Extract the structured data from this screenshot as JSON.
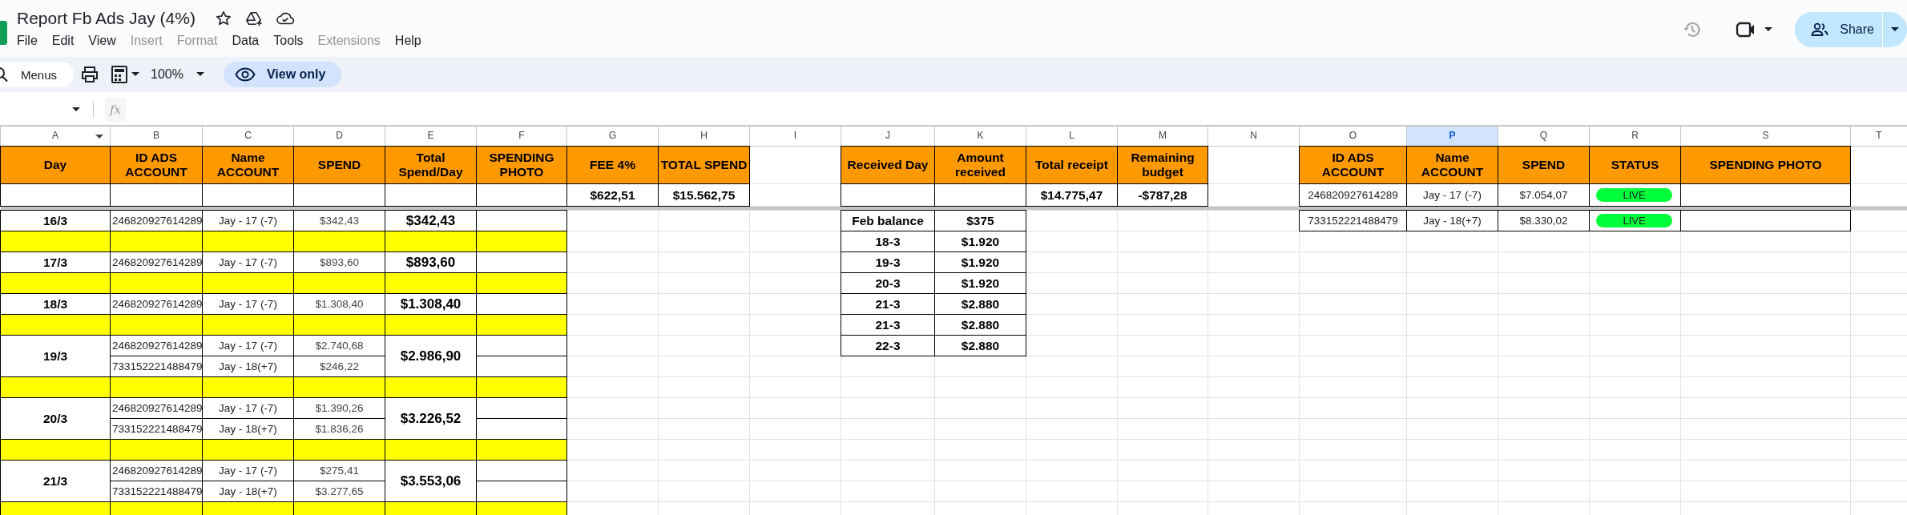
{
  "title": "Report Fb Ads Jay (4%)",
  "menu": [
    {
      "label": "File",
      "disabled": false
    },
    {
      "label": "Edit",
      "disabled": false
    },
    {
      "label": "View",
      "disabled": false
    },
    {
      "label": "Insert",
      "disabled": true
    },
    {
      "label": "Format",
      "disabled": true
    },
    {
      "label": "Data",
      "disabled": false
    },
    {
      "label": "Tools",
      "disabled": false
    },
    {
      "label": "Extensions",
      "disabled": true
    },
    {
      "label": "Help",
      "disabled": false
    }
  ],
  "toolbar": {
    "search_placeholder": "Menus",
    "zoom": "100%",
    "mode": "View only"
  },
  "share": {
    "label": "Share"
  },
  "formula_bar": {
    "fx": "fx"
  },
  "columns": [
    {
      "letter": "A",
      "selected": false
    },
    {
      "letter": "B",
      "selected": false
    },
    {
      "letter": "C",
      "selected": false
    },
    {
      "letter": "D",
      "selected": false
    },
    {
      "letter": "E",
      "selected": false
    },
    {
      "letter": "F",
      "selected": false
    },
    {
      "letter": "G",
      "selected": false
    },
    {
      "letter": "H",
      "selected": false
    },
    {
      "letter": "I",
      "selected": false
    },
    {
      "letter": "J",
      "selected": false
    },
    {
      "letter": "K",
      "selected": false
    },
    {
      "letter": "L",
      "selected": false
    },
    {
      "letter": "M",
      "selected": false
    },
    {
      "letter": "N",
      "selected": false
    },
    {
      "letter": "O",
      "selected": false
    },
    {
      "letter": "P",
      "selected": true
    },
    {
      "letter": "Q",
      "selected": false
    },
    {
      "letter": "R",
      "selected": false
    },
    {
      "letter": "S",
      "selected": false
    },
    {
      "letter": "T",
      "selected": false
    }
  ],
  "spend_table": {
    "headers": [
      "Day",
      "ID ADS ACCOUNT",
      "Name ACCOUNT",
      "SPEND",
      "Total Spend/Day",
      "SPENDING PHOTO",
      "FEE 4%",
      "TOTAL SPEND"
    ],
    "fee": "$622,51",
    "total_spend": "$15.562,75",
    "days": [
      {
        "day": "16/3",
        "total": "$342,43",
        "accounts": [
          {
            "id": "246820927614289",
            "name": "Jay - 17 (-7)",
            "spend": "$342,43"
          }
        ]
      },
      {
        "day": "17/3",
        "total": "$893,60",
        "accounts": [
          {
            "id": "246820927614289",
            "name": "Jay - 17 (-7)",
            "spend": "$893,60"
          }
        ]
      },
      {
        "day": "18/3",
        "total": "$1.308,40",
        "accounts": [
          {
            "id": "246820927614289",
            "name": "Jay - 17 (-7)",
            "spend": "$1.308,40"
          }
        ]
      },
      {
        "day": "19/3",
        "total": "$2.986,90",
        "accounts": [
          {
            "id": "246820927614289",
            "name": "Jay - 17 (-7)",
            "spend": "$2.740,68"
          },
          {
            "id": "733152221488479",
            "name": "Jay - 18(+7)",
            "spend": "$246,22"
          }
        ]
      },
      {
        "day": "20/3",
        "total": "$3.226,52",
        "accounts": [
          {
            "id": "246820927614289",
            "name": "Jay - 17 (-7)",
            "spend": "$1.390,26"
          },
          {
            "id": "733152221488479",
            "name": "Jay - 18(+7)",
            "spend": "$1.836,26"
          }
        ]
      },
      {
        "day": "21/3",
        "total": "$3.553,06",
        "accounts": [
          {
            "id": "246820927614289",
            "name": "Jay - 17 (-7)",
            "spend": "$275,41"
          },
          {
            "id": "733152221488479",
            "name": "Jay - 18(+7)",
            "spend": "$3.277,65"
          }
        ]
      }
    ]
  },
  "receipts": {
    "headers": [
      "Received Day",
      "Amount received",
      "Total receipt",
      "Remaining budget"
    ],
    "total_receipt": "$14.775,47",
    "remaining_budget": "-$787,28",
    "rows": [
      {
        "day": "Feb balance",
        "amount": "$375"
      },
      {
        "day": "18-3",
        "amount": "$1.920"
      },
      {
        "day": "19-3",
        "amount": "$1.920"
      },
      {
        "day": "20-3",
        "amount": "$1.920"
      },
      {
        "day": "21-3",
        "amount": "$2.880"
      },
      {
        "day": "21-3",
        "amount": "$2.880"
      },
      {
        "day": "22-3",
        "amount": "$2.880"
      }
    ]
  },
  "accounts": {
    "headers": [
      "ID ADS ACCOUNT",
      "Name ACCOUNT",
      "SPEND",
      "STATUS",
      "SPENDING PHOTO"
    ],
    "rows": [
      {
        "id": "246820927614289",
        "name": "Jay - 17 (-7)",
        "spend": "$7.054,07",
        "status": "LIVE"
      },
      {
        "id": "733152221488479",
        "name": "Jay - 18(+7)",
        "spend": "$8.330,02",
        "status": "LIVE"
      }
    ]
  }
}
